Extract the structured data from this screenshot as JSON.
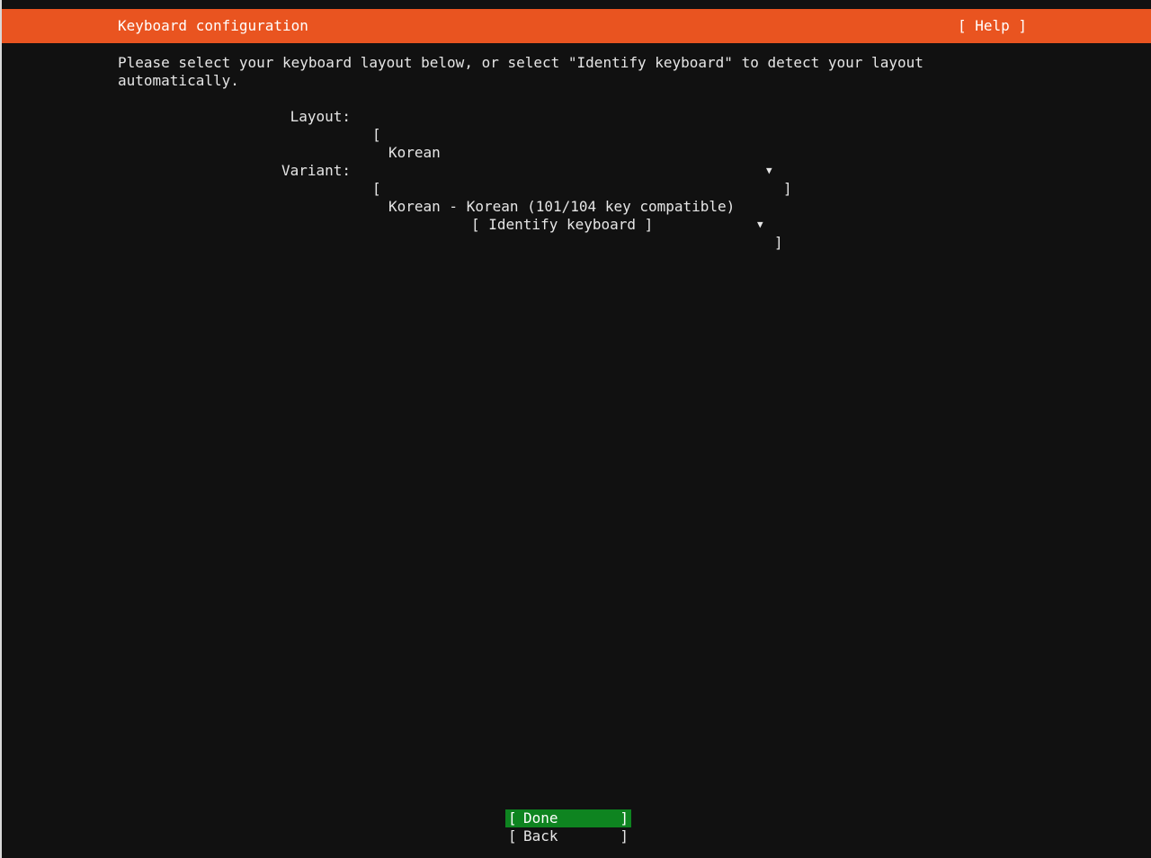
{
  "header": {
    "title": "Keyboard configuration",
    "help_label": "[ Help ]",
    "bg_color": "#e95420"
  },
  "intro": {
    "line1": "Please select your keyboard layout below, or select \"Identify keyboard\" to detect your layout",
    "line2": "automatically."
  },
  "form": {
    "layout": {
      "label": "Layout:",
      "value": "Korean",
      "open_bracket": "[",
      "close_bracket": "]",
      "arrow": "▼"
    },
    "variant": {
      "label": "Variant:",
      "value": "Korean - Korean (101/104 key compatible)",
      "open_bracket": "[",
      "close_bracket": "]",
      "arrow": "▼"
    },
    "identify_label": "[ Identify keyboard ]"
  },
  "buttons": {
    "open_bracket": "[",
    "close_bracket": "]",
    "done_label": "Done",
    "back_label": "Back",
    "done_bg_color": "#0e8420"
  }
}
